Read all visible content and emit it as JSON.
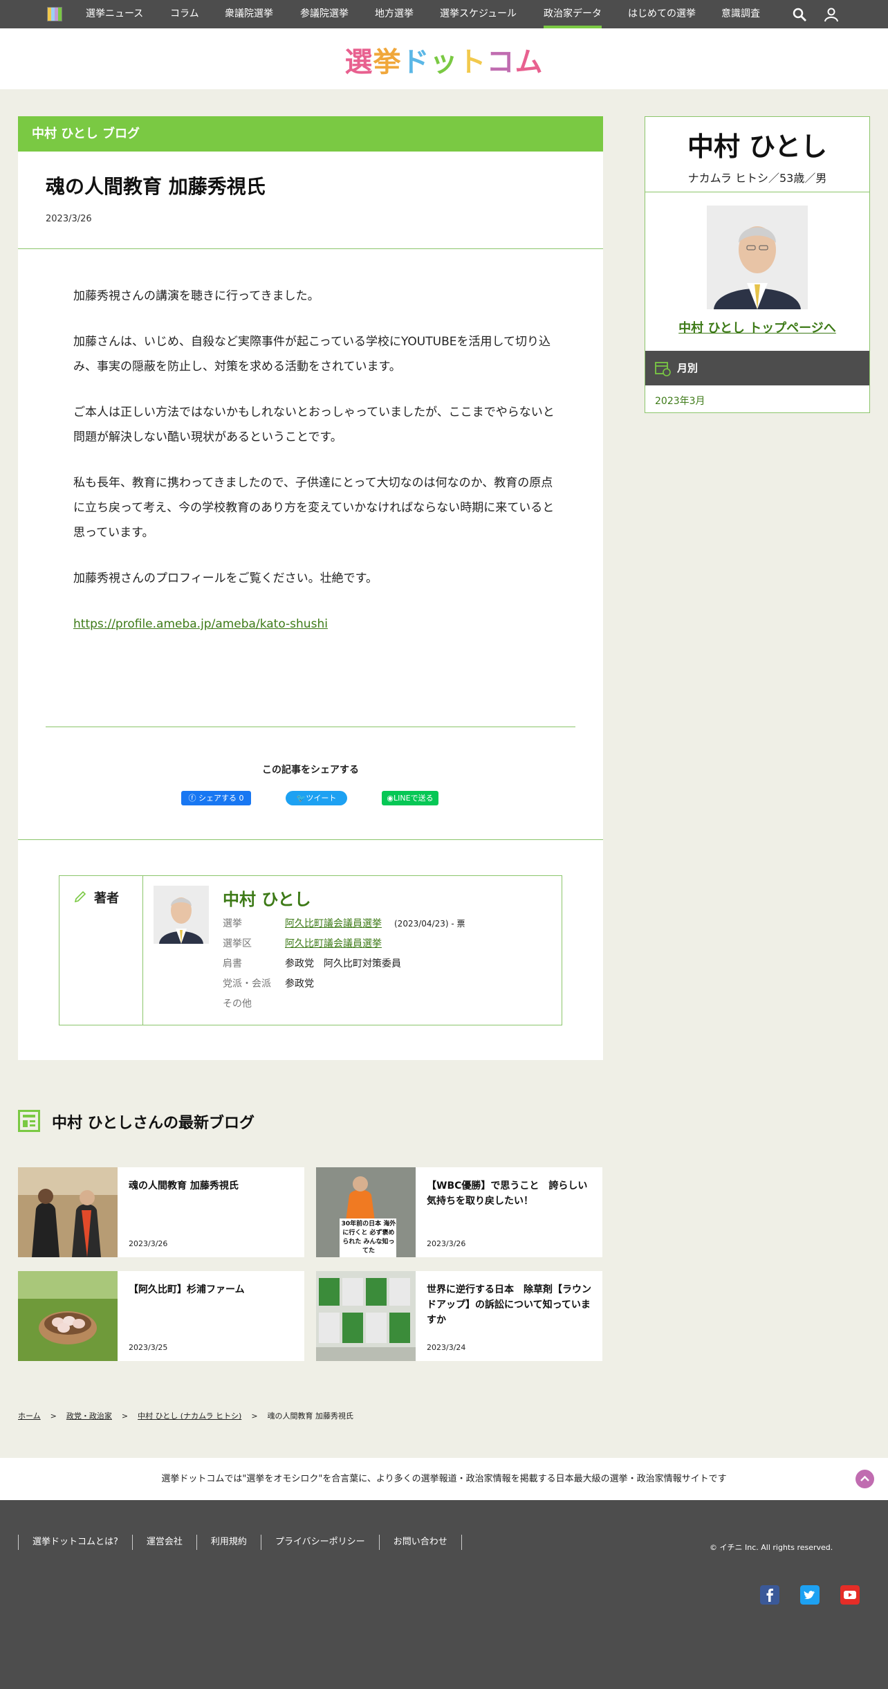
{
  "nav": {
    "items": [
      "選挙ニュース",
      "コラム",
      "衆議院選挙",
      "参議院選挙",
      "地方選挙",
      "選挙スケジュール",
      "政治家データ",
      "はじめての選挙",
      "意識調査"
    ],
    "active": "政治家データ"
  },
  "logo": "選挙ドットコム",
  "blog_header": "中村 ひとし ブログ",
  "post": {
    "title": "魂の人間教育 加藤秀視氏",
    "date": "2023/3/26",
    "paragraphs": [
      "加藤秀視さんの講演を聴きに行ってきました。",
      "加藤さんは、いじめ、自殺など実際事件が起こっている学校にYOUTUBEを活用して切り込み、事実の隠蔽を防止し、対策を求める活動をされています。",
      "ご本人は正しい方法ではないかもしれないとおっしゃっていましたが、ここまでやらないと問題が解決しない酷い現状があるということです。",
      "私も長年、教育に携わってきましたので、子供達にとって大切なのは何なのか、教育の原点に立ち戻って考え、今の学校教育のあり方を変えていかなければならない時期に来ていると思っています。",
      "加藤秀視さんのプロフィールをご覧ください。壮絶です。"
    ],
    "link": "https://profile.ameba.jp/ameba/kato-shushi"
  },
  "share": {
    "title": "この記事をシェアする",
    "facebook": "シェアする 0",
    "twitter": "ツイート",
    "line": "LINEで送る"
  },
  "author": {
    "label": "著者",
    "name": "中村 ひとし",
    "rows": [
      {
        "key": "選挙",
        "value": "阿久比町議会議員選挙",
        "extra": "(2023/04/23) - 票"
      },
      {
        "key": "選挙区",
        "value": "阿久比町議会議員選挙",
        "extra": ""
      },
      {
        "key": "肩書",
        "value": "参政党　阿久比町対策委員",
        "extra": ""
      },
      {
        "key": "党派・会派",
        "value": "参政党",
        "extra": ""
      },
      {
        "key": "その他",
        "value": "",
        "extra": ""
      }
    ]
  },
  "sidebar": {
    "name": "中村 ひとし",
    "kana": "ナカムラ ヒトシ／53歳／男",
    "top_link": "中村 ひとし トップページへ",
    "monthly_label": "月別",
    "months": [
      "2023年3月"
    ]
  },
  "latest": {
    "title": "中村 ひとしさんの最新ブログ",
    "cards": [
      {
        "title": "魂の人間教育 加藤秀視氏",
        "date": "2023/3/26",
        "thumb_text": ""
      },
      {
        "title": "【WBC優勝】で思うこと　誇らしい気持ちを取り戻したい！",
        "date": "2023/3/26",
        "thumb_text": "30年前の日本 海外に行くと 必ず褒められた みんな知ってた"
      },
      {
        "title": "【阿久比町】杉浦ファーム",
        "date": "2023/3/25",
        "thumb_text": ""
      },
      {
        "title": "世界に逆行する日本　除草剤【ラウンドアップ】の訴訟について知っていますか",
        "date": "2023/3/24",
        "thumb_text": ""
      }
    ]
  },
  "breadcrumb": [
    "ホーム",
    "政党・政治家",
    "中村 ひとし (ナカムラ ヒトシ)",
    "魂の人間教育 加藤秀視氏"
  ],
  "tagline": "選挙ドットコムでは\"選挙をオモシロク\"を合言葉に、より多くの選挙報道・政治家情報を掲載する日本最大級の選挙・政治家情報サイトです",
  "footer": {
    "links": [
      "選挙ドットコムとは?",
      "運営会社",
      "利用規約",
      "プライバシーポリシー",
      "お問い合わせ"
    ],
    "copyright": "© イチニ Inc. All rights reserved."
  },
  "colors": {
    "accent": "#7ac943",
    "dark": "#4d4d4d",
    "link": "#3d7a17",
    "facebook": "#1877f2",
    "twitter": "#1da1f2",
    "line": "#06c755",
    "youtube": "#ff0000"
  }
}
